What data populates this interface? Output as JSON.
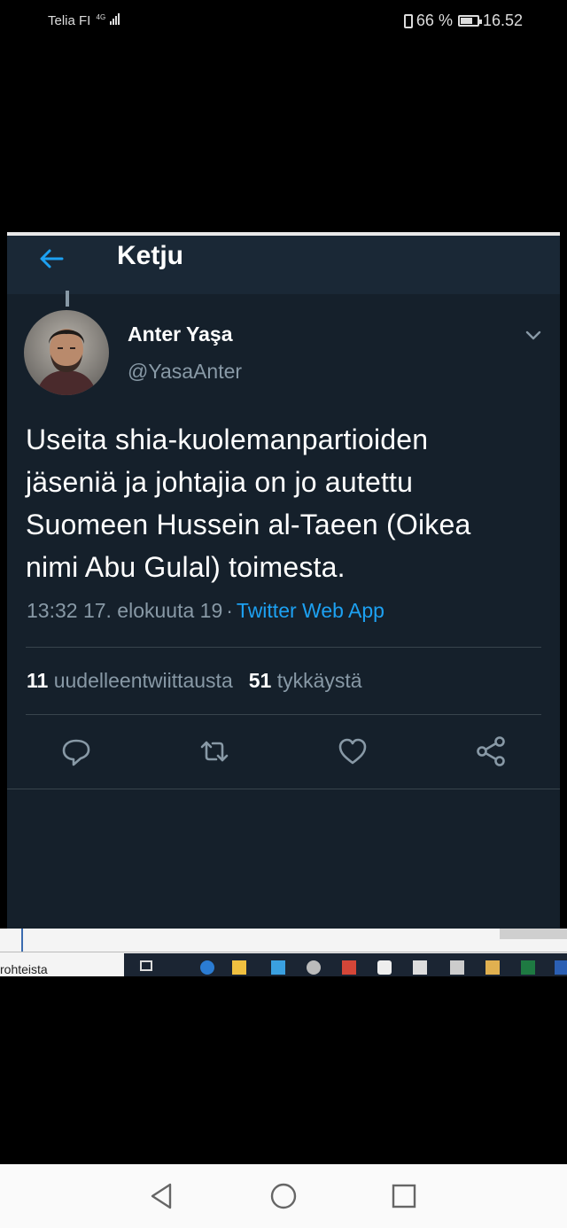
{
  "status_bar": {
    "carrier": "Telia FI",
    "network": "4G",
    "battery": "66 %",
    "time": "16.52"
  },
  "header": {
    "back_icon": "arrow-left-icon",
    "title": "Ketju"
  },
  "tweet": {
    "author_name": "Anter Yaşa",
    "author_handle": "@YasaAnter",
    "text_lines": [
      "Useita shia-kuolemanpartioiden",
      "jäseniä ja johtajia on jo autettu",
      "Suomeen Hussein al-Taeen (Oikea",
      "nimi Abu Gulal) toimesta."
    ],
    "timestamp": "13:32 17. elokuuta 19",
    "separator": "·",
    "client": "Twitter Web App",
    "retweet_count": "11",
    "retweet_label": "uudelleentwiittausta",
    "like_count": "51",
    "like_label": "tykkäystä"
  },
  "actions": [
    {
      "icon": "reply-icon"
    },
    {
      "icon": "retweet-icon"
    },
    {
      "icon": "like-heart-icon"
    },
    {
      "icon": "share-icon"
    }
  ],
  "background_desktop": {
    "partial_text": "rohteista"
  },
  "nav_bar": {
    "back_icon": "triangle-back-icon",
    "home_icon": "circle-home-icon",
    "recents_icon": "square-recents-icon"
  },
  "colors": {
    "background": "#15202b",
    "header": "#1a2836",
    "accent": "#1da1f2",
    "secondary_text": "#8899a6",
    "divider": "#38444d"
  }
}
